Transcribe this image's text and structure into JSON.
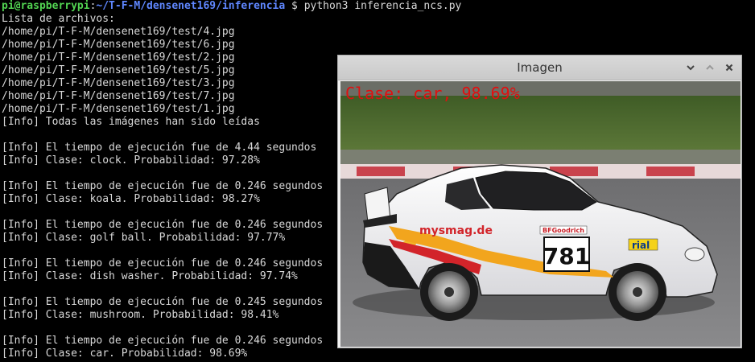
{
  "terminal": {
    "prompt": {
      "user_host": "pi@raspberrypi",
      "colon": ":",
      "path": "~/T-F-M/densenet169/inferencia",
      "symbol": " $ ",
      "command": "python3 inferencia_ncs.py"
    },
    "lines": [
      "Lista de archivos:",
      "/home/pi/T-F-M/densenet169/test/4.jpg",
      "/home/pi/T-F-M/densenet169/test/6.jpg",
      "/home/pi/T-F-M/densenet169/test/2.jpg",
      "/home/pi/T-F-M/densenet169/test/5.jpg",
      "/home/pi/T-F-M/densenet169/test/3.jpg",
      "/home/pi/T-F-M/densenet169/test/7.jpg",
      "/home/pi/T-F-M/densenet169/test/1.jpg",
      "[Info] Todas las imágenes han sido leídas",
      "",
      "[Info] El tiempo de ejecución fue de 4.44 segundos",
      "[Info] Clase: clock. Probabilidad: 97.28%",
      "",
      "[Info] El tiempo de ejecución fue de 0.246 segundos",
      "[Info] Clase: koala. Probabilidad: 98.27%",
      "",
      "[Info] El tiempo de ejecución fue de 0.246 segundos",
      "[Info] Clase: golf ball. Probabilidad: 97.77%",
      "",
      "[Info] El tiempo de ejecución fue de 0.246 segundos",
      "[Info] Clase: dish washer. Probabilidad: 97.74%",
      "",
      "[Info] El tiempo de ejecución fue de 0.245 segundos",
      "[Info] Clase: mushroom. Probabilidad: 98.41%",
      "",
      "[Info] El tiempo de ejecución fue de 0.246 segundos",
      "[Info] Clase: car. Probabilidad: 98.69%"
    ]
  },
  "image_window": {
    "title": "Imagen",
    "buttons": {
      "menu_icon": "chevron-down-icon",
      "maximize_icon": "chevron-up-icon",
      "close_icon": "close-icon"
    },
    "overlay_label": "Clase: car, 98.69%",
    "car": {
      "number": "781",
      "sponsor_main": "mysmag.de",
      "sponsor_tire": "BFGoodrich",
      "sponsor_rial": "rial"
    }
  },
  "colors": {
    "prompt_user": "#52d452",
    "prompt_path": "#5f87ff",
    "overlay_text": "#e01010"
  }
}
